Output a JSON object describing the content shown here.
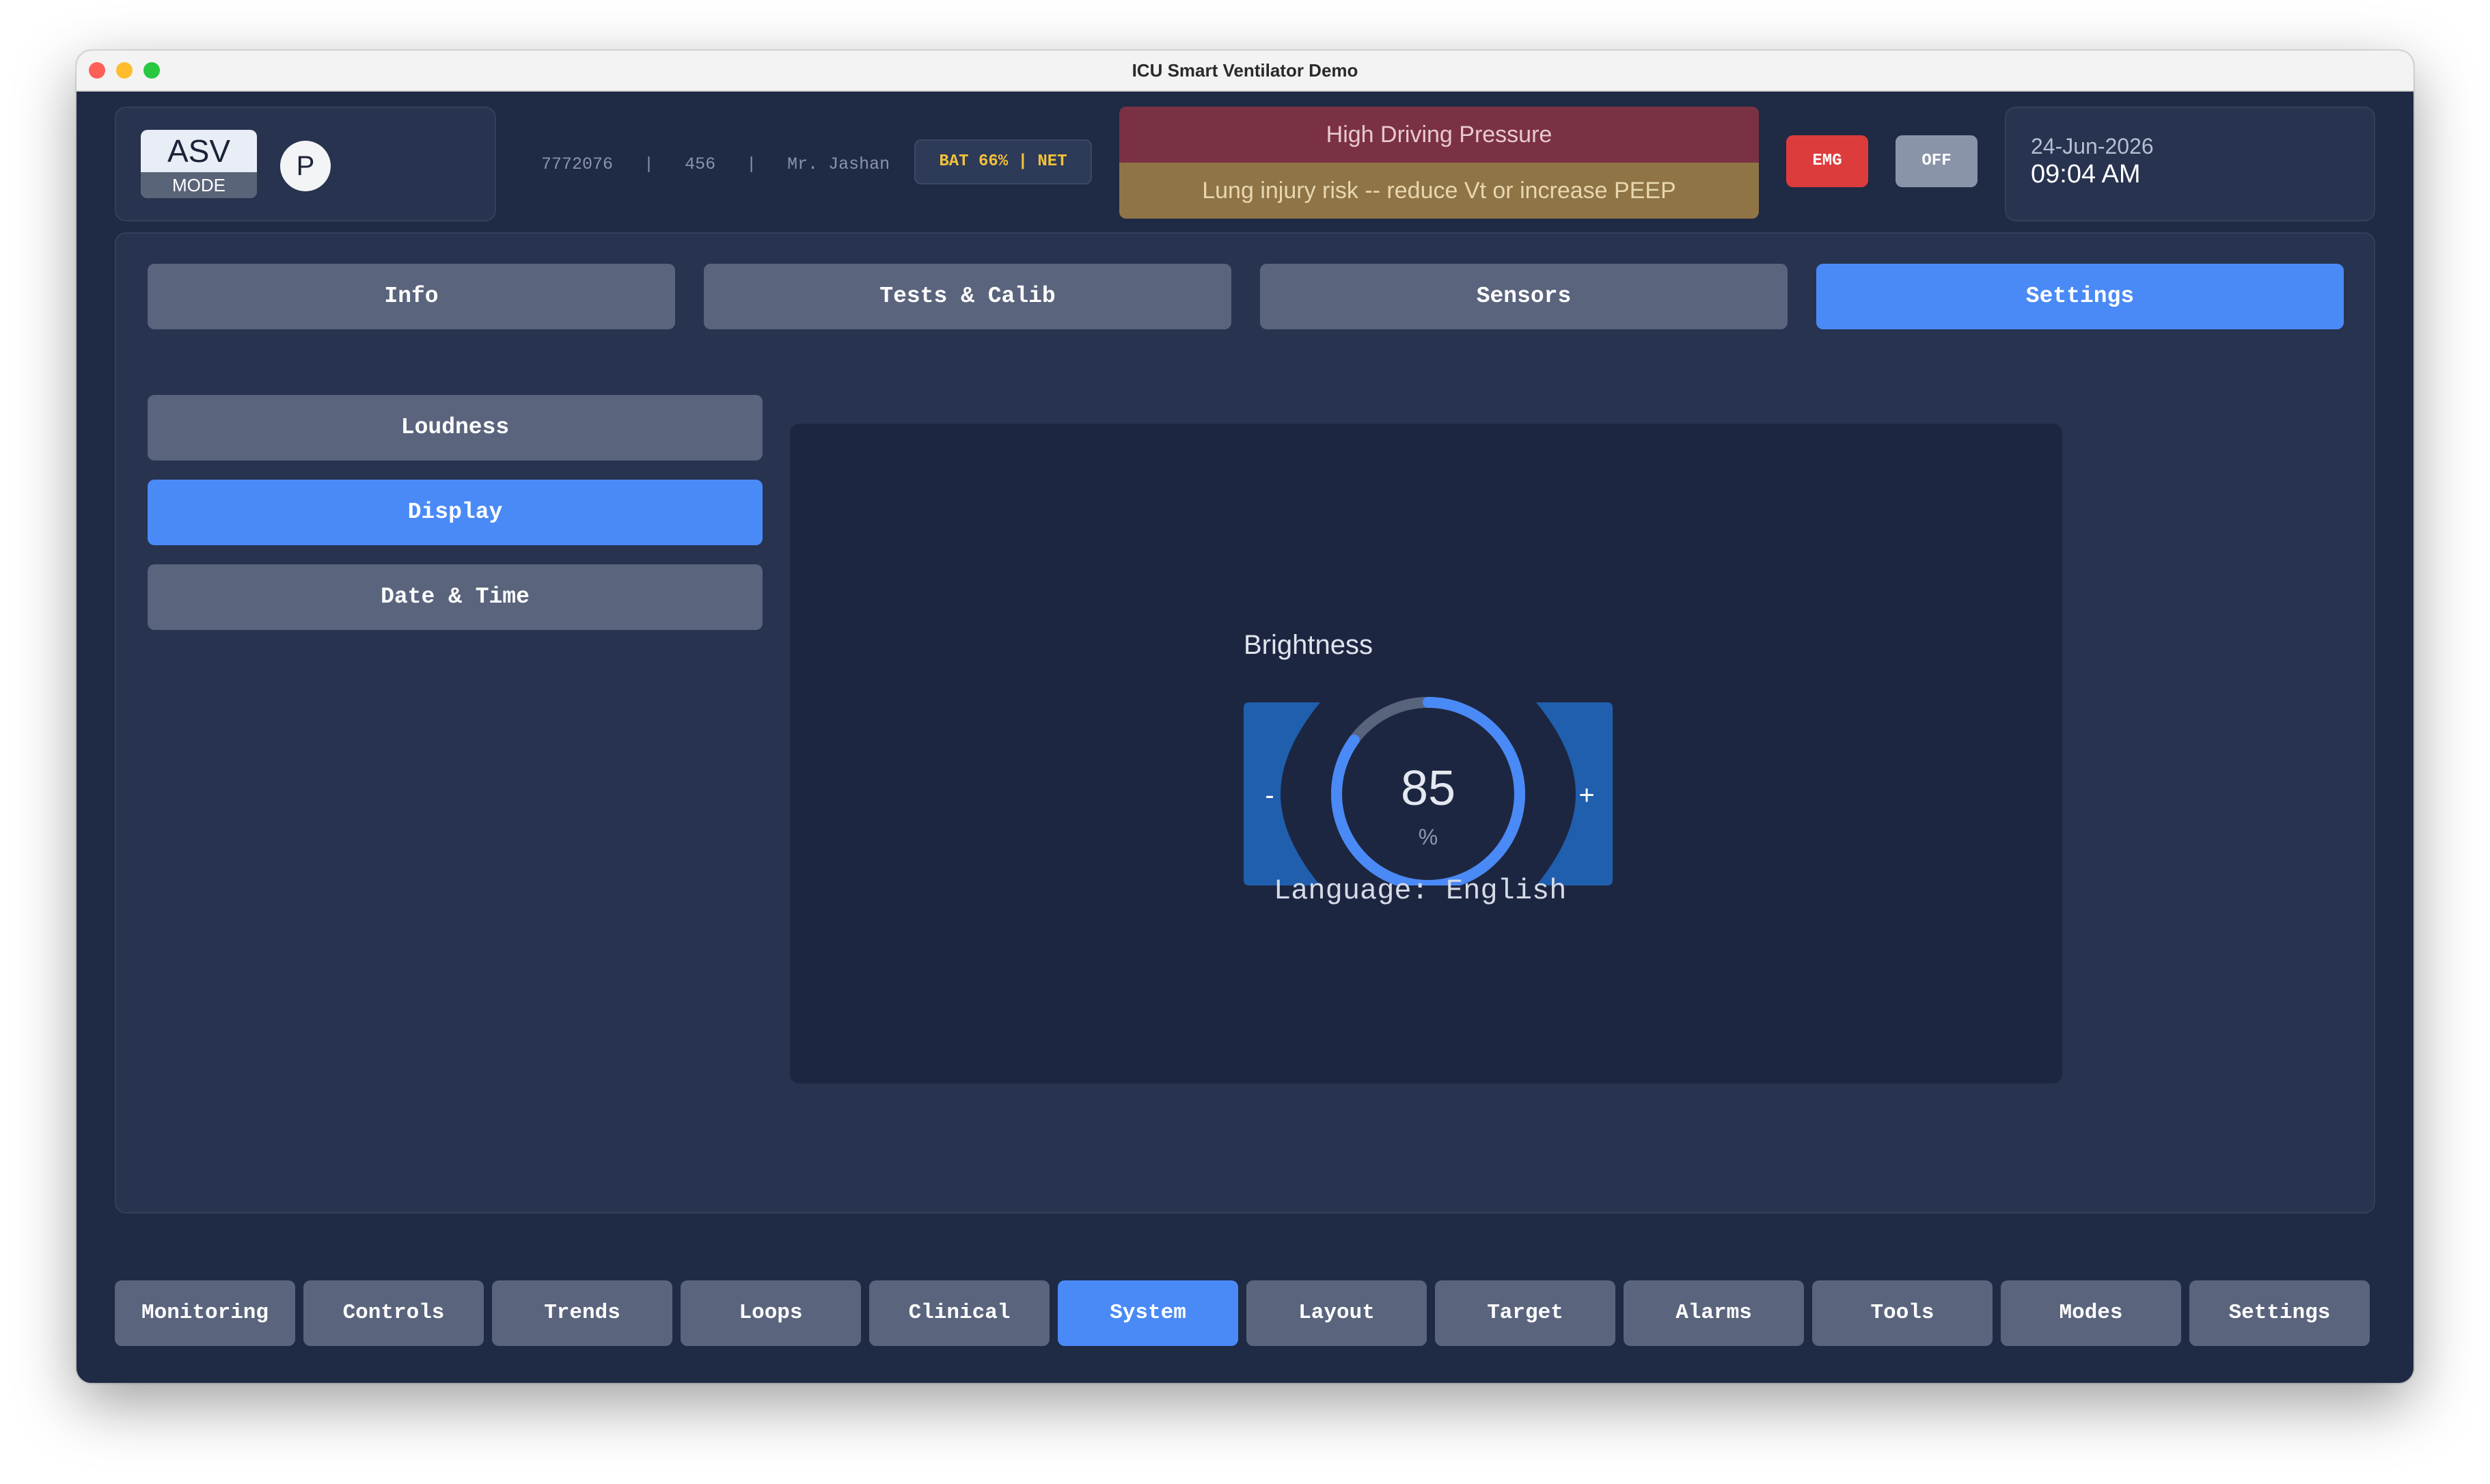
{
  "window": {
    "title": "ICU Smart Ventilator Demo"
  },
  "header": {
    "mode_name": "ASV",
    "mode_label": "MODE",
    "profile_initial": "P",
    "patient_id": "7772076",
    "bed": "456",
    "patient_name": "Mr. Jashan",
    "separator": "|",
    "status": "BAT 66% | NET",
    "alarm_title": "High Driving Pressure",
    "alarm_message": "Lung injury risk -- reduce Vt or increase PEEP",
    "emg_label": "EMG",
    "off_label": "OFF",
    "date": "24-Jun-2026",
    "time": "09:04 AM"
  },
  "tabs": [
    {
      "label": "Info"
    },
    {
      "label": "Tests & Calib"
    },
    {
      "label": "Sensors"
    },
    {
      "label": "Settings",
      "active": true
    }
  ],
  "side_menu": [
    {
      "label": "Loudness"
    },
    {
      "label": "Display",
      "active": true
    },
    {
      "label": "Date & Time"
    }
  ],
  "display": {
    "brightness_label": "Brightness",
    "brightness_value": "85",
    "brightness_unit": "%",
    "brightness_fraction": 0.85,
    "decrement": "-",
    "increment": "+",
    "language": "Language: English"
  },
  "nav": [
    {
      "label": "Monitoring"
    },
    {
      "label": "Controls"
    },
    {
      "label": "Trends"
    },
    {
      "label": "Loops"
    },
    {
      "label": "Clinical"
    },
    {
      "label": "System",
      "active": true
    },
    {
      "label": "Layout"
    },
    {
      "label": "Target"
    },
    {
      "label": "Alarms"
    },
    {
      "label": "Tools"
    },
    {
      "label": "Modes"
    },
    {
      "label": "Settings"
    }
  ],
  "colors": {
    "background": "#1f2a44",
    "accent": "#4a8af7",
    "alarm_red": "#7b3144",
    "alarm_amber": "#8f7446",
    "emg": "#dc3c3c"
  }
}
